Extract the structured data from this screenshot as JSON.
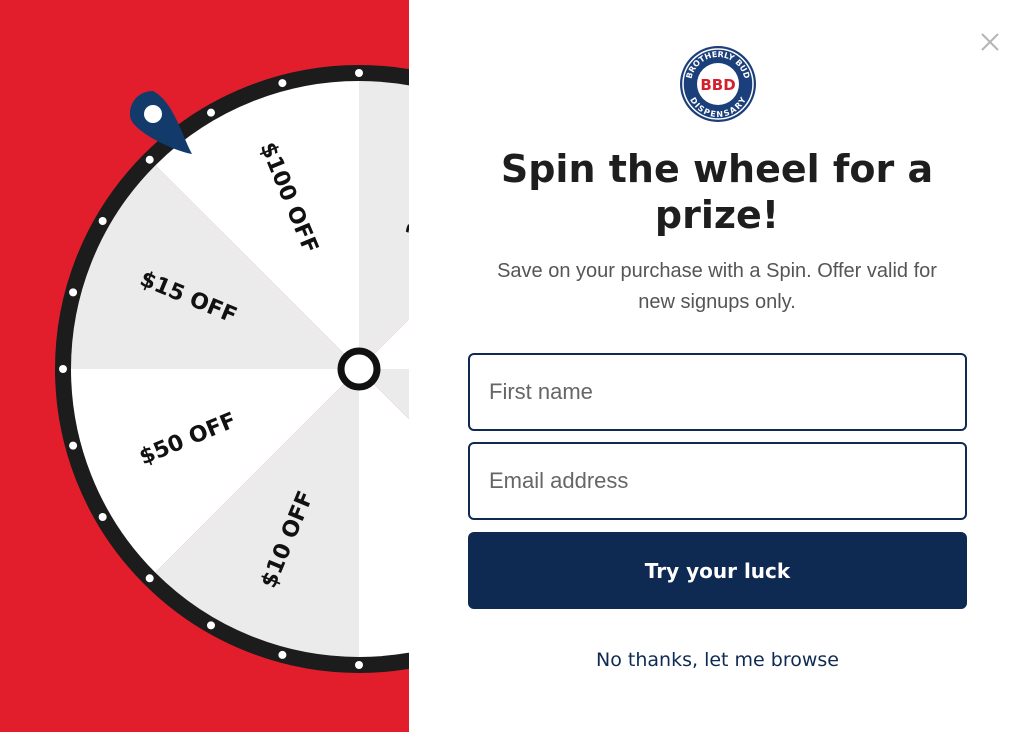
{
  "theme": {
    "brand_red": "#e31e2c",
    "navy": "#0f2a52",
    "wheel_rim": "#1c1c1c",
    "segment_light": "#ebebeb",
    "segment_white": "#ffffff"
  },
  "wheel": {
    "segments": [
      "$100 OFF",
      "$15 OFF",
      "$50 OFF",
      "$10 OFF"
    ],
    "partial_segments": [
      "1",
      "1"
    ]
  },
  "logo": {
    "text_top": "BROTHERLY BUD",
    "text_bottom": "DISPENSARY",
    "monogram": "BBD"
  },
  "popup": {
    "title": "Spin the wheel for a prize!",
    "subtitle": "Save on your purchase with a Spin. Offer valid for new signups only.",
    "first_name_placeholder": "First name",
    "email_placeholder": "Email address",
    "cta_label": "Try your luck",
    "decline_label": "No thanks, let me browse"
  },
  "icons": {
    "close": "close-icon",
    "pointer": "map-pin-icon"
  }
}
